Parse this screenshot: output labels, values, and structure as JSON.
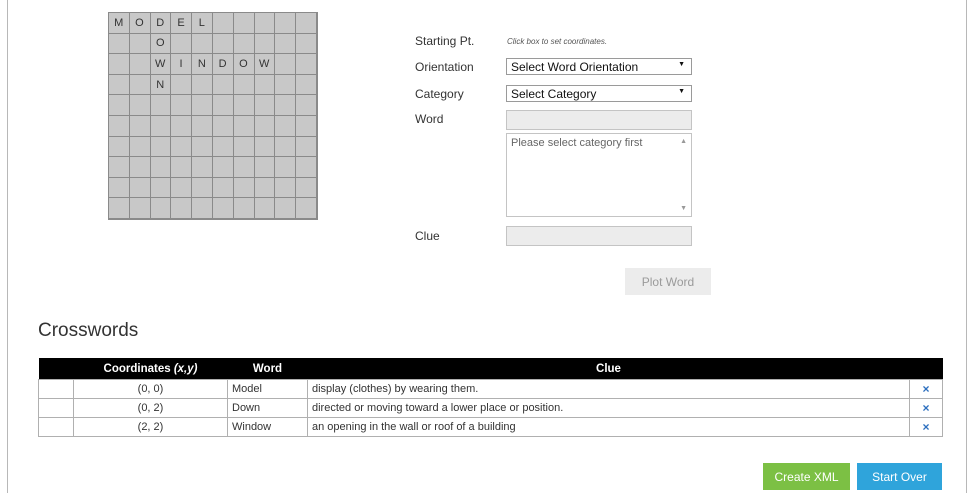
{
  "grid": {
    "cols": 10,
    "rows": 10,
    "cells": {
      "0,0": "M",
      "1,0": "O",
      "2,0": "D",
      "3,0": "E",
      "4,0": "L",
      "2,1": "O",
      "2,2": "W",
      "3,2": "I",
      "4,2": "N",
      "5,2": "D",
      "6,2": "O",
      "7,2": "W",
      "2,3": "N"
    }
  },
  "form": {
    "starting_label": "Starting Pt.",
    "starting_hint": "Click box to set coordinates.",
    "orientation_label": "Orientation",
    "orientation_value": "Select Word Orientation",
    "category_label": "Category",
    "category_value": "Select Category",
    "word_label": "Word",
    "textarea_placeholder": "Please select category first",
    "clue_label": "Clue",
    "plot_button": "Plot Word"
  },
  "crosswords": {
    "title": "Crosswords",
    "headers": [
      "",
      "Coordinates (x,y)",
      "Word",
      "Clue",
      ""
    ],
    "rows": [
      {
        "coord": "(0, 0)",
        "word": "Model",
        "clue": "display (clothes) by wearing them."
      },
      {
        "coord": "(0, 2)",
        "word": "Down",
        "clue": "directed or moving toward a lower place or position."
      },
      {
        "coord": "(2, 2)",
        "word": "Window",
        "clue": "an opening in the wall or roof of a building"
      }
    ],
    "delete_icon": "×"
  },
  "buttons": {
    "create_xml": "Create XML",
    "start_over": "Start Over"
  },
  "colors": {
    "grid_bg": "#c8c8c8",
    "create_xml": "#7cc044",
    "start_over": "#2fa4db",
    "delete_icon": "#2c6fbf"
  }
}
